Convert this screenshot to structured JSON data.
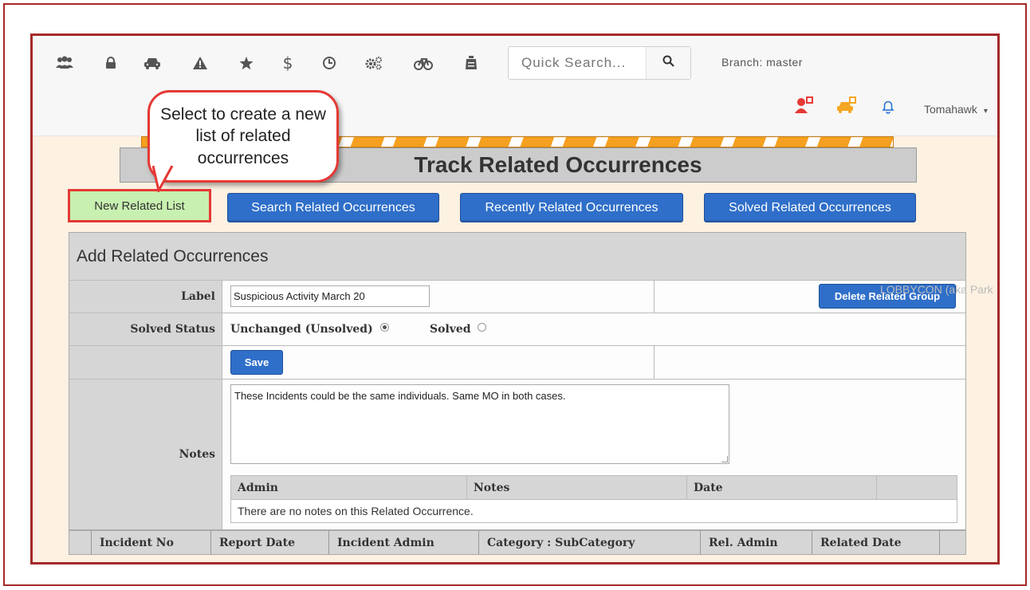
{
  "toolbar": {
    "icons": [
      "users-icon",
      "lock-icon",
      "car-icon",
      "warning-icon",
      "star-icon",
      "dollar-icon",
      "clock-icon",
      "cogs-icon",
      "bicycle-icon",
      "bag-icon"
    ],
    "search_placeholder": "Quick Search...",
    "branch": "Branch: master",
    "user_name": "Tomahawk"
  },
  "callout": {
    "text": "Select to create a new list of related occurrences"
  },
  "page": {
    "title": "Track Related Occurrences"
  },
  "actions": {
    "new_list": "New Related List",
    "search": "Search Related Occurrences",
    "recent": "Recently Related Occurrences",
    "solved": "Solved Related Occurrences"
  },
  "form": {
    "header": "Add Related Occurrences",
    "label_label": "Label",
    "label_value": "Suspicious Activity March 20",
    "delete_button": "Delete Related Group",
    "solved_status_label": "Solved Status",
    "status_unchanged": "Unchanged (Unsolved)",
    "status_solved": "Solved",
    "save_button": "Save",
    "notes_label": "Notes",
    "notes_value": "These Incidents could be the same individuals. Same MO in both cases.",
    "ghost_text": "LOBBYCON (aka Park"
  },
  "notes_table": {
    "columns": [
      "Admin",
      "Notes",
      "Date"
    ],
    "empty_message": "There are no notes on this Related Occurrence."
  },
  "occurrence_table": {
    "columns": [
      "Incident No",
      "Report Date",
      "Incident Admin",
      "Category : SubCategory",
      "Rel. Admin",
      "Related Date"
    ]
  },
  "colors": {
    "accent_blue": "#2f6fc9",
    "highlight_red": "#e53935",
    "frame_red": "#a52a2a",
    "new_button_green": "#c8f0b0"
  }
}
